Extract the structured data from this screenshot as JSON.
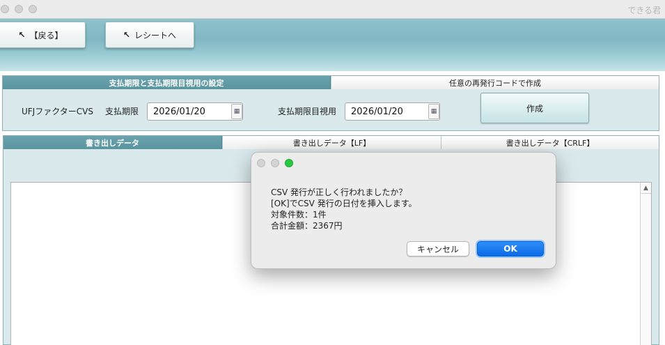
{
  "window": {
    "title": "できる君"
  },
  "toolbar": {
    "back_label": "【戻る】",
    "receipt_label": "レシートへ"
  },
  "settings_panel": {
    "tab_active": "支払期限と支払期限目視用の設定",
    "tab_inactive": "任意の再発行コードで作成",
    "ufj_label": "UFJファクターCVS",
    "due_label": "支払期限",
    "due_value": "2026/01/20",
    "visual_due_label": "支払期限目視用",
    "visual_due_value": "2026/01/20",
    "make_button": "作成"
  },
  "export_panel": {
    "tabs": [
      {
        "label": "書き出しデータ"
      },
      {
        "label": "書き出しデータ【LF】"
      },
      {
        "label": "書き出しデータ【CRLF】"
      }
    ]
  },
  "dialog": {
    "lines": [
      "CSV 発行が正しく行われましたか？",
      "[OK]でCSV 発行の日付を挿入します。",
      "対象件数：1件",
      "合計金額：2367円"
    ],
    "cancel_label": "キャンセル",
    "ok_label": "OK"
  },
  "colors": {
    "accent": "#5a949f",
    "ok_button": "#1a7cf0",
    "close_dot": "#d3d3d3",
    "zoom_dot": "#2ac840"
  }
}
